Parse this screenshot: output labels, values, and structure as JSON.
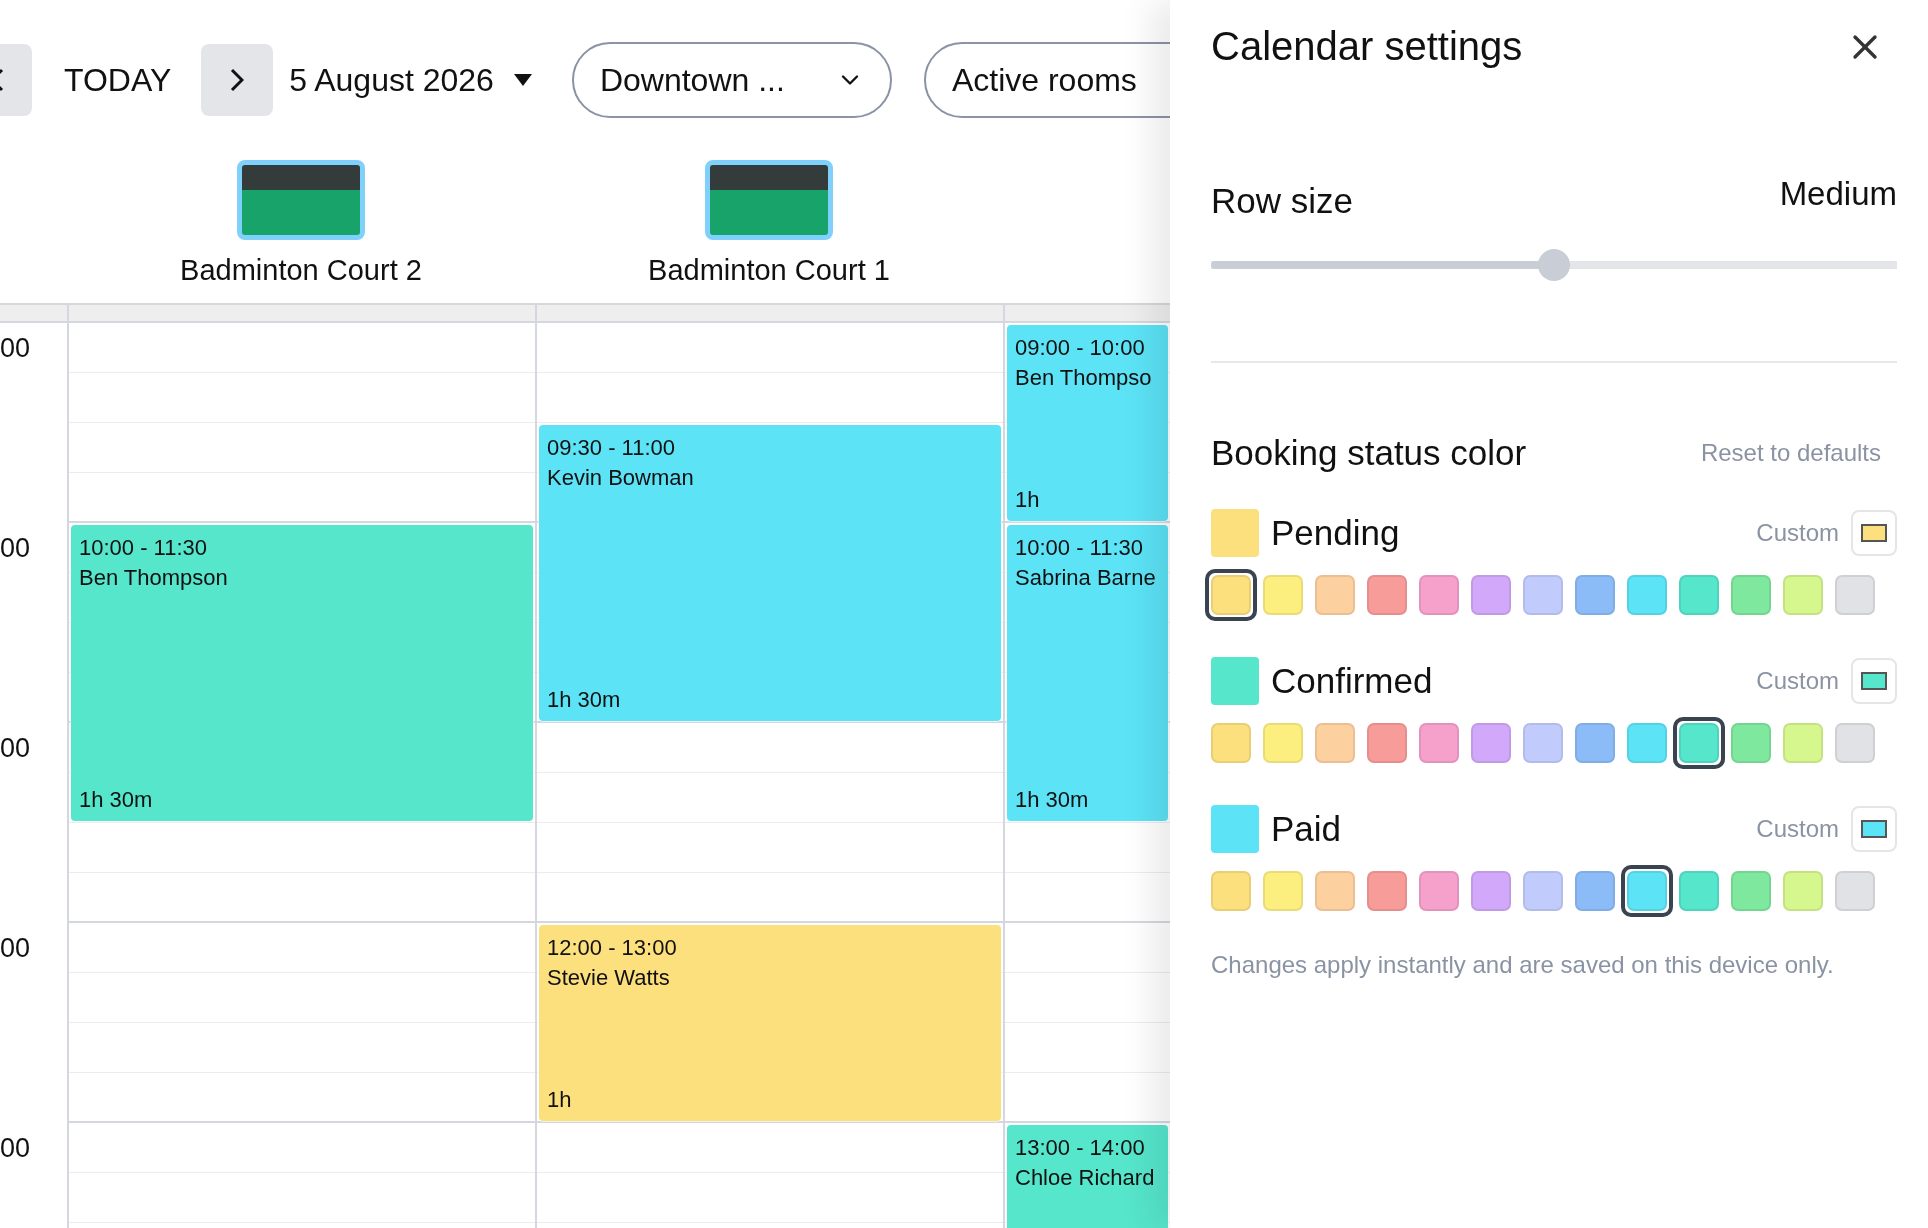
{
  "toolbar": {
    "today": "TODAY",
    "date": "5 August 2026",
    "location": "Downtown ...",
    "rooms_filter": "Active rooms"
  },
  "rooms": [
    {
      "name": "Badminton Court 2"
    },
    {
      "name": "Badminton Court 1"
    }
  ],
  "hours": [
    "00",
    "00",
    "00",
    "00",
    "00"
  ],
  "columns": [
    {
      "bookings": [
        {
          "time": "10:00 - 11:30",
          "name": "Ben Thompson",
          "duration": "1h 30m",
          "color": "#55e6cc"
        }
      ]
    },
    {
      "bookings": [
        {
          "time": "09:30 - 11:00",
          "name": "Kevin Bowman",
          "duration": "1h 30m",
          "color": "#5ce3f6"
        },
        {
          "time": "12:00 - 13:00",
          "name": "Stevie Watts",
          "duration": "1h",
          "color": "#fde07e"
        }
      ]
    },
    {
      "bookings": [
        {
          "time": "09:00 - 10:00",
          "name": "Ben Thompso",
          "duration": "1h",
          "color": "#5ce3f6"
        },
        {
          "time": "10:00 - 11:30",
          "name": "Sabrina Barne",
          "duration": "1h 30m",
          "color": "#5ce3f6"
        },
        {
          "time": "13:00 - 14:00",
          "name": "Chloe Richard",
          "color": "#55e6cc"
        }
      ]
    }
  ],
  "settings": {
    "title": "Calendar settings",
    "row_size": {
      "label": "Row size",
      "value": "Medium",
      "level": 0.5
    },
    "status_section": {
      "title": "Booking status color",
      "reset": "Reset to defaults",
      "statuses": [
        {
          "label": "Pending",
          "color": "#fde07e",
          "custom": "Custom",
          "swatches": [
            {
              "color": "#fde07e",
              "selected": true
            },
            {
              "color": "#fdee80",
              "selected": false
            },
            {
              "color": "#fdd0a0",
              "selected": false
            },
            {
              "color": "#f89c9a",
              "selected": false
            },
            {
              "color": "#f6a0cc",
              "selected": false
            },
            {
              "color": "#d2a8fa",
              "selected": false
            },
            {
              "color": "#c2ccfc",
              "selected": false
            },
            {
              "color": "#8bbcf8",
              "selected": false
            },
            {
              "color": "#5ce3f6",
              "selected": false
            },
            {
              "color": "#55e6cc",
              "selected": false
            },
            {
              "color": "#7ee89e",
              "selected": false
            },
            {
              "color": "#d6f68e",
              "selected": false
            },
            {
              "color": "#e0e2e6",
              "selected": false
            }
          ]
        },
        {
          "label": "Confirmed",
          "color": "#55e6cc",
          "custom": "Custom",
          "swatches": [
            {
              "color": "#fde07e",
              "selected": false
            },
            {
              "color": "#fdee80",
              "selected": false
            },
            {
              "color": "#fdd0a0",
              "selected": false
            },
            {
              "color": "#f89c9a",
              "selected": false
            },
            {
              "color": "#f6a0cc",
              "selected": false
            },
            {
              "color": "#d2a8fa",
              "selected": false
            },
            {
              "color": "#c2ccfc",
              "selected": false
            },
            {
              "color": "#8bbcf8",
              "selected": false
            },
            {
              "color": "#5ce3f6",
              "selected": false
            },
            {
              "color": "#55e6cc",
              "selected": true
            },
            {
              "color": "#7ee89e",
              "selected": false
            },
            {
              "color": "#d6f68e",
              "selected": false
            },
            {
              "color": "#e0e2e6",
              "selected": false
            }
          ]
        },
        {
          "label": "Paid",
          "color": "#5ce3f6",
          "custom": "Custom",
          "swatches": [
            {
              "color": "#fde07e",
              "selected": false
            },
            {
              "color": "#fdee80",
              "selected": false
            },
            {
              "color": "#fdd0a0",
              "selected": false
            },
            {
              "color": "#f89c9a",
              "selected": false
            },
            {
              "color": "#f6a0cc",
              "selected": false
            },
            {
              "color": "#d2a8fa",
              "selected": false
            },
            {
              "color": "#c2ccfc",
              "selected": false
            },
            {
              "color": "#8bbcf8",
              "selected": false
            },
            {
              "color": "#5ce3f6",
              "selected": true
            },
            {
              "color": "#55e6cc",
              "selected": false
            },
            {
              "color": "#7ee89e",
              "selected": false
            },
            {
              "color": "#d6f68e",
              "selected": false
            },
            {
              "color": "#e0e2e6",
              "selected": false
            }
          ]
        }
      ]
    },
    "note": "Changes apply instantly and are saved on this device only."
  }
}
